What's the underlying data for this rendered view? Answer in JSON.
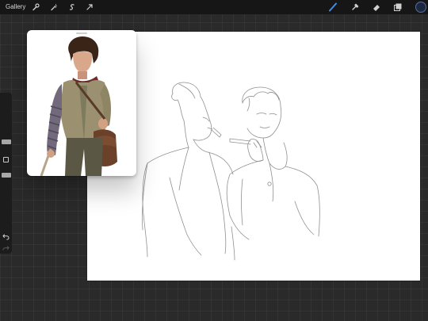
{
  "toolbar": {
    "gallery_label": "Gallery",
    "left_tools": [
      "wrench-icon",
      "magic-wand-icon",
      "selection-icon",
      "transform-arrow-icon"
    ],
    "right_tools": [
      "brush-icon",
      "smudge-icon",
      "eraser-icon",
      "layers-icon"
    ],
    "active_tool": "brush-icon",
    "active_color": "#1b2840",
    "active_tool_color": "#3d8ff0"
  },
  "sidebar": {
    "controls": [
      "brush-size-slider",
      "modify-button",
      "brush-opacity-slider",
      "undo-icon",
      "redo-icon"
    ]
  },
  "reference_window": {
    "content": "reference-character-illustration"
  },
  "canvas": {
    "background": "#ffffff",
    "content": "pencil-sketch-two-figures"
  }
}
